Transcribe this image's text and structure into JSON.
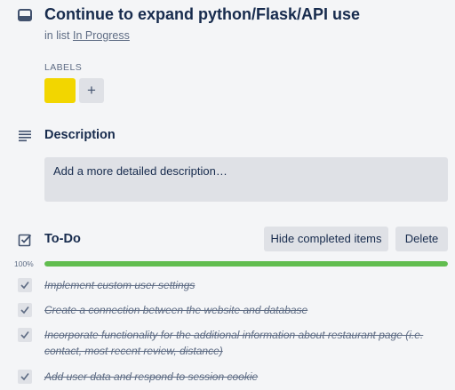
{
  "card": {
    "title": "Continue to expand python/Flask/API use",
    "in_list_prefix": "in list",
    "list_name": "In Progress"
  },
  "labels": {
    "heading": "LABELS",
    "items": [
      {
        "color": "#f2d600"
      }
    ],
    "add_label": "+"
  },
  "description": {
    "heading": "Description",
    "placeholder": "Add a more detailed description…"
  },
  "checklist": {
    "title": "To-Do",
    "hide_completed_label": "Hide completed items",
    "delete_label": "Delete",
    "progress_label": "100%",
    "progress": 1.0,
    "items": [
      {
        "text": "Implement custom user settings",
        "checked": true
      },
      {
        "text": "Create a connection between the website and database",
        "checked": true
      },
      {
        "text": "Incorporate functionality for the additional information about restaurant page (i.e. contact, most recent review, distance)",
        "checked": true
      },
      {
        "text": "Add user data and respond to session cookie",
        "checked": true
      }
    ]
  },
  "colors": {
    "label_yellow": "#f2d600",
    "progress_green": "#61bd4f"
  }
}
